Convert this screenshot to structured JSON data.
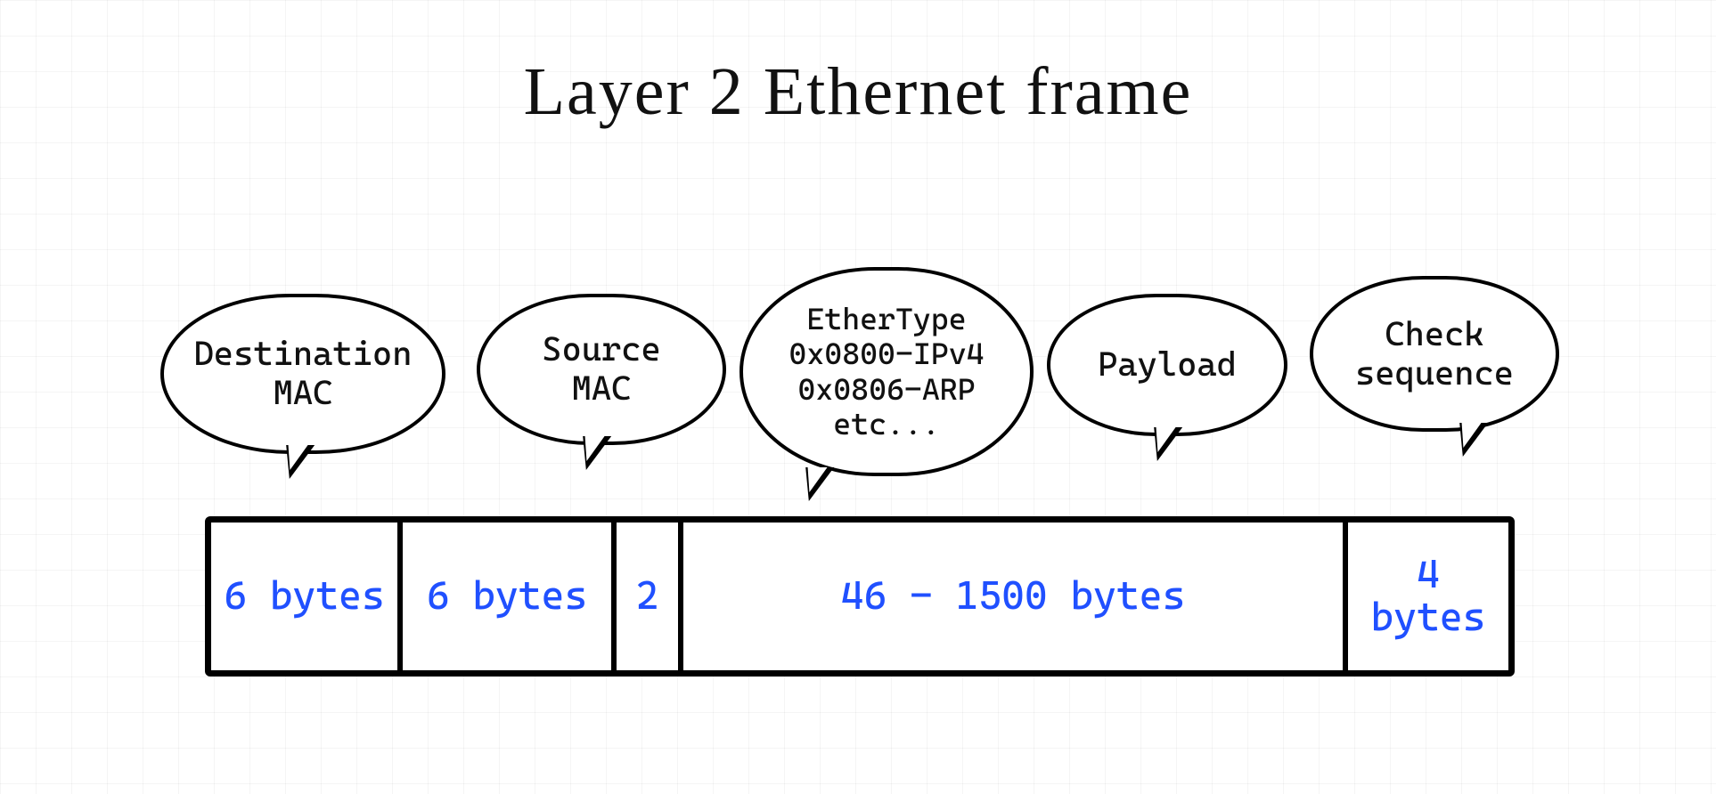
{
  "title": "Layer 2 Ethernet frame",
  "bubbles": {
    "dest": "Destination\nMAC",
    "src": "Source\nMAC",
    "type": "EtherType\n0x0800-IPv4\n0x0806-ARP\netc...",
    "payload": "Payload",
    "check": "Check\nsequence"
  },
  "segments": {
    "dest": "6\nbytes",
    "src": "6\nbytes",
    "type": "2",
    "payload": "46 - 1500\nbytes",
    "check": "4\nbytes"
  },
  "colors": {
    "byteText": "#2050ff",
    "stroke": "#000000"
  }
}
